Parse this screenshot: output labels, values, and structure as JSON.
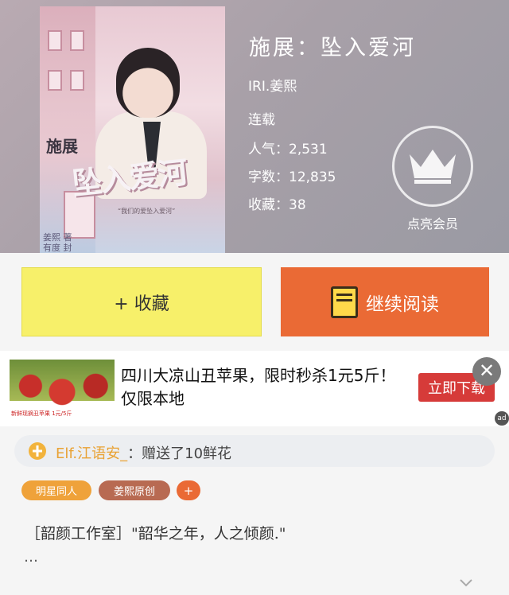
{
  "book": {
    "title": "施展：坠入爱河",
    "author": "IRI.姜熙",
    "status": "连载",
    "popularity": "人气：2,531",
    "word_count": "字数：12,835",
    "favorites": "收藏：38"
  },
  "cover": {
    "title_small": "施展",
    "title_large": "坠入爱河",
    "subtitle": "“我们的爱坠入爱河”",
    "credit_line1": "姜熙 著",
    "credit_line2": "有度 封"
  },
  "vip": {
    "label": "点亮会员",
    "icon": "crown-icon"
  },
  "actions": {
    "favorite_label": "+ 收藏",
    "read_label": "继续阅读"
  },
  "ad": {
    "text": "四川大凉山丑苹果，限时秒杀1元5斤！仅限本地",
    "image_caption": "新鲜现摘丑苹果 1元/5斤",
    "download_label": "立即下载",
    "close_symbol": "✕",
    "mark": "ad"
  },
  "gift": {
    "user": "Elf.江语安_",
    "message": "：赠送了10鲜花"
  },
  "tags": [
    {
      "label": "明星同人",
      "color": "#efa23a"
    },
    {
      "label": "姜熙原创",
      "color": "#b86a52"
    },
    {
      "label": "+",
      "color": "#ea6a35"
    }
  ],
  "content": {
    "intro": "［韶颜工作室］\"韶华之年，人之倾颜.\"",
    "more": "…"
  },
  "colors": {
    "favorite_button": "#f7f06a",
    "read_button": "#ea6a35",
    "ad_button": "#d63b39"
  }
}
